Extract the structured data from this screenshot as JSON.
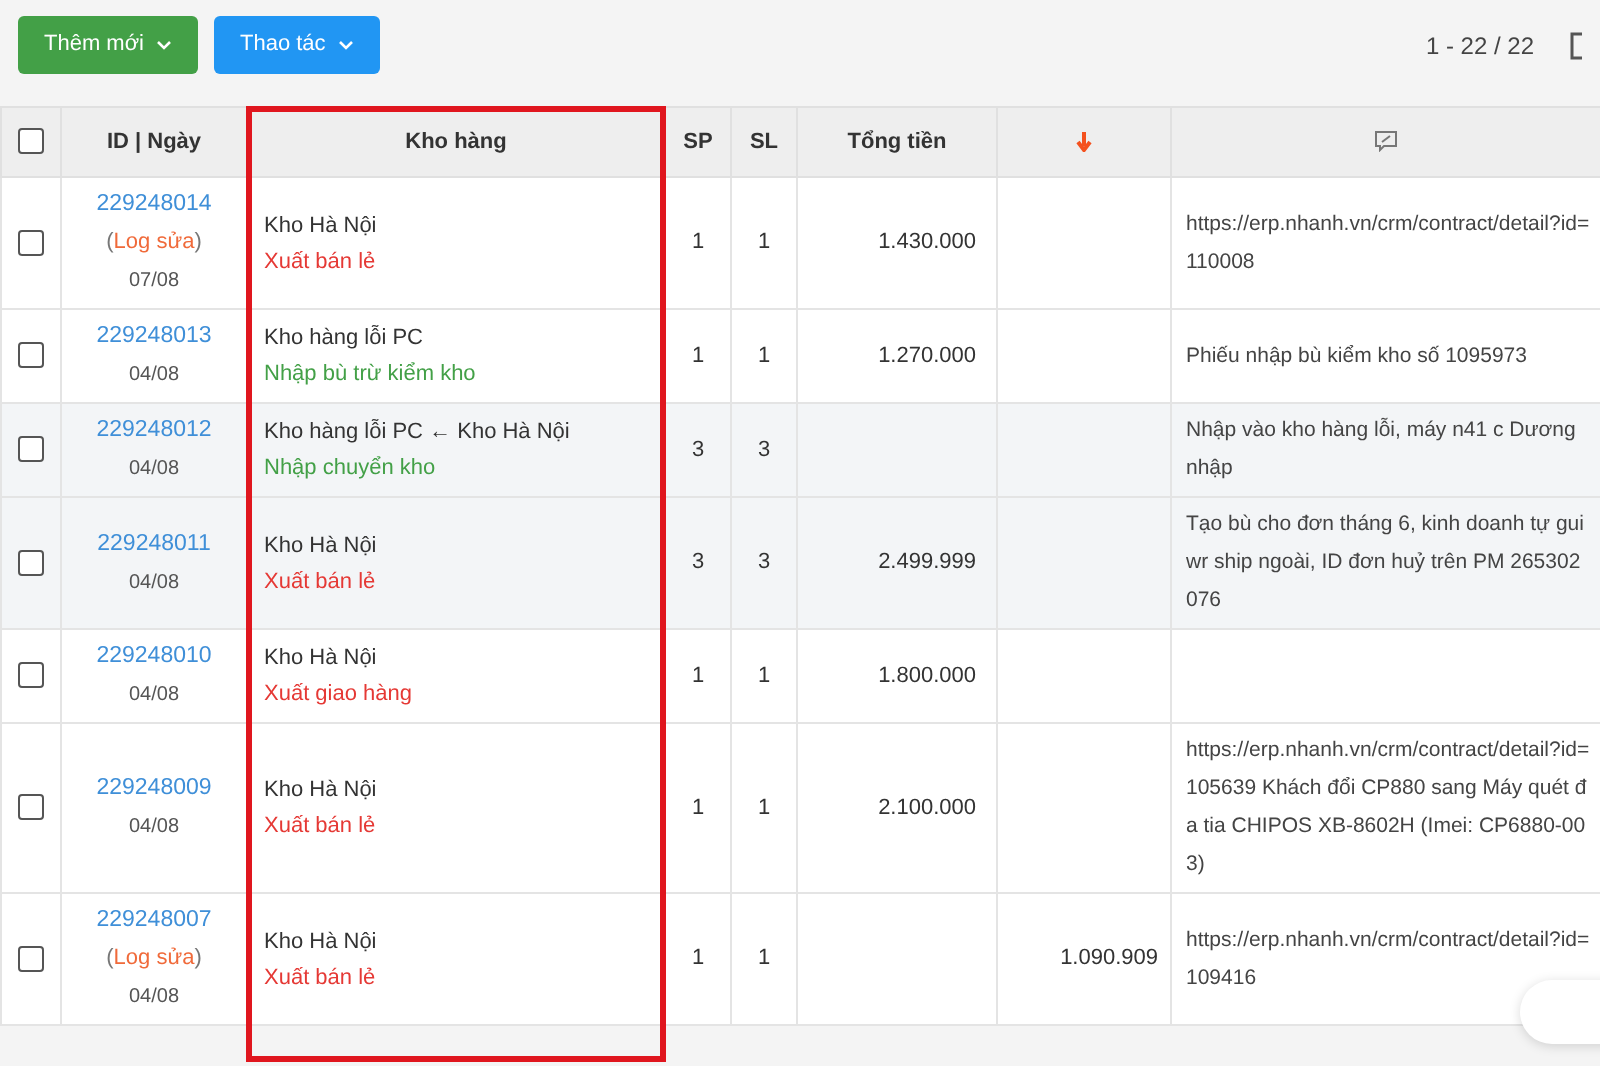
{
  "toolbar": {
    "buttons": [
      {
        "label": "Thêm mới",
        "color": "#43a047"
      },
      {
        "label": "Thao tác",
        "color": "#2196f3"
      }
    ],
    "pagination": "1 - 22 / 22"
  },
  "table": {
    "select_all": {
      "checked": false
    },
    "columns": [
      {
        "kind": "text",
        "label": "ID | Ngày"
      },
      {
        "kind": "text",
        "label": "Kho hàng"
      },
      {
        "kind": "text",
        "label": "SP"
      },
      {
        "kind": "text",
        "label": "SL"
      },
      {
        "kind": "text",
        "label": "Tổng tiền"
      },
      {
        "kind": "sort-icon"
      },
      {
        "kind": "note-icon"
      }
    ],
    "rows": [
      {
        "checked": false,
        "highlighted": false,
        "id": "229248014",
        "edit_log": {
          "open": "(",
          "label": "Log sửa",
          "close": ")"
        },
        "date": "07/08",
        "warehouse": "Kho Hà Nội",
        "transaction": {
          "kind": "export",
          "label": "Xuất bán lẻ"
        },
        "sp": "1",
        "sl": "1",
        "total": "1.430.000",
        "note": "https://erp.nhanh.vn/crm/contract/detail?id=110008"
      },
      {
        "checked": false,
        "highlighted": false,
        "id": "229248013",
        "date": "04/08",
        "warehouse": "Kho hàng lỗi PC",
        "transaction": {
          "kind": "import",
          "label": "Nhập bù trừ kiểm kho"
        },
        "sp": "1",
        "sl": "1",
        "total": "1.270.000",
        "note": "Phiếu nhập bù kiểm kho số 1095973"
      },
      {
        "checked": false,
        "highlighted": true,
        "id": "229248012",
        "date": "04/08",
        "warehouse": "Kho hàng lỗi PC ← Kho Hà Nội",
        "transaction": {
          "kind": "import",
          "label": "Nhập chuyển kho"
        },
        "sp": "3",
        "sl": "3",
        "note": "Nhập vào kho hàng lỗi, máy n41 c Dương nhập"
      },
      {
        "checked": false,
        "highlighted": true,
        "id": "229248011",
        "date": "04/08",
        "warehouse": "Kho Hà Nội",
        "transaction": {
          "kind": "export",
          "label": "Xuất bán lẻ"
        },
        "sp": "3",
        "sl": "3",
        "total": "2.499.999",
        "note": "Tạo bù cho đơn tháng 6, kinh doanh tự guiwr ship ngoài, ID đơn huỷ trên PM  265302076"
      },
      {
        "checked": false,
        "highlighted": false,
        "id": "229248010",
        "date": "04/08",
        "warehouse": "Kho Hà Nội",
        "transaction": {
          "kind": "export",
          "label": "Xuất giao hàng"
        },
        "sp": "1",
        "sl": "1",
        "total": "1.800.000"
      },
      {
        "checked": false,
        "highlighted": false,
        "id": "229248009",
        "date": "04/08",
        "warehouse": "Kho Hà Nội",
        "transaction": {
          "kind": "export",
          "label": "Xuất bán lẻ"
        },
        "sp": "1",
        "sl": "1",
        "total": "2.100.000",
        "note": "https://erp.nhanh.vn/crm/contract/detail?id=105639 Khách đổi CP880 sang Máy quét đa tia CHIPOS XB-8602H (Imei: CP6880-003)"
      },
      {
        "checked": false,
        "highlighted": false,
        "id": "229248007",
        "edit_log": {
          "open": "(",
          "label": "Log sửa",
          "close": ")"
        },
        "date": "04/08",
        "warehouse": "Kho Hà Nội",
        "transaction": {
          "kind": "export",
          "label": "Xuất bán lẻ"
        },
        "sp": "1",
        "sl": "1",
        "column_7": "1.090.909",
        "note": "https://erp.nhanh.vn/crm/contract/detail?id=109416"
      }
    ]
  }
}
